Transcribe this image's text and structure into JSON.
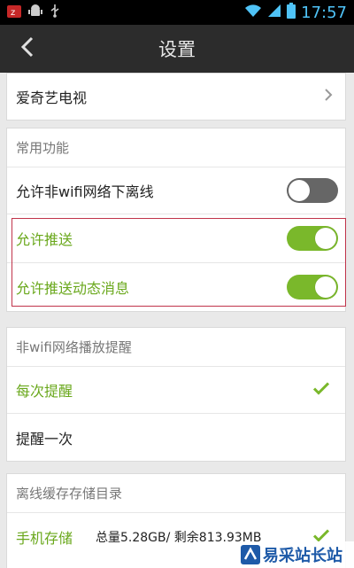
{
  "status_bar": {
    "time": "17:57",
    "icons": [
      "z-app-icon",
      "android-icon",
      "usb-icon",
      "wifi-icon",
      "signal-icon",
      "battery-icon"
    ]
  },
  "header": {
    "title": "设置",
    "back_icon": "chevron-left-icon"
  },
  "app_card": {
    "label": "爱奇艺电视"
  },
  "common": {
    "header": "常用功能",
    "rows": [
      {
        "label": "允许非wifi网络下离线",
        "toggle": "off"
      },
      {
        "label": "允许推送",
        "toggle": "on"
      },
      {
        "label": "允许推送动态消息",
        "toggle": "on"
      }
    ]
  },
  "reminder": {
    "header": "非wifi网络播放提醒",
    "options": [
      {
        "label": "每次提醒",
        "selected": true
      },
      {
        "label": "提醒一次",
        "selected": false
      }
    ]
  },
  "storage": {
    "header": "离线缓存存储目录",
    "option_label": "手机存储",
    "size_text": "总量5.28GB/ 剩余813.93MB"
  },
  "watermark": {
    "text": "易采站长站"
  },
  "colors": {
    "accent_green": "#7ab82b",
    "toggle_off": "#666666",
    "highlight_red": "#c0334a",
    "titlebar": "#2c2c2c"
  }
}
